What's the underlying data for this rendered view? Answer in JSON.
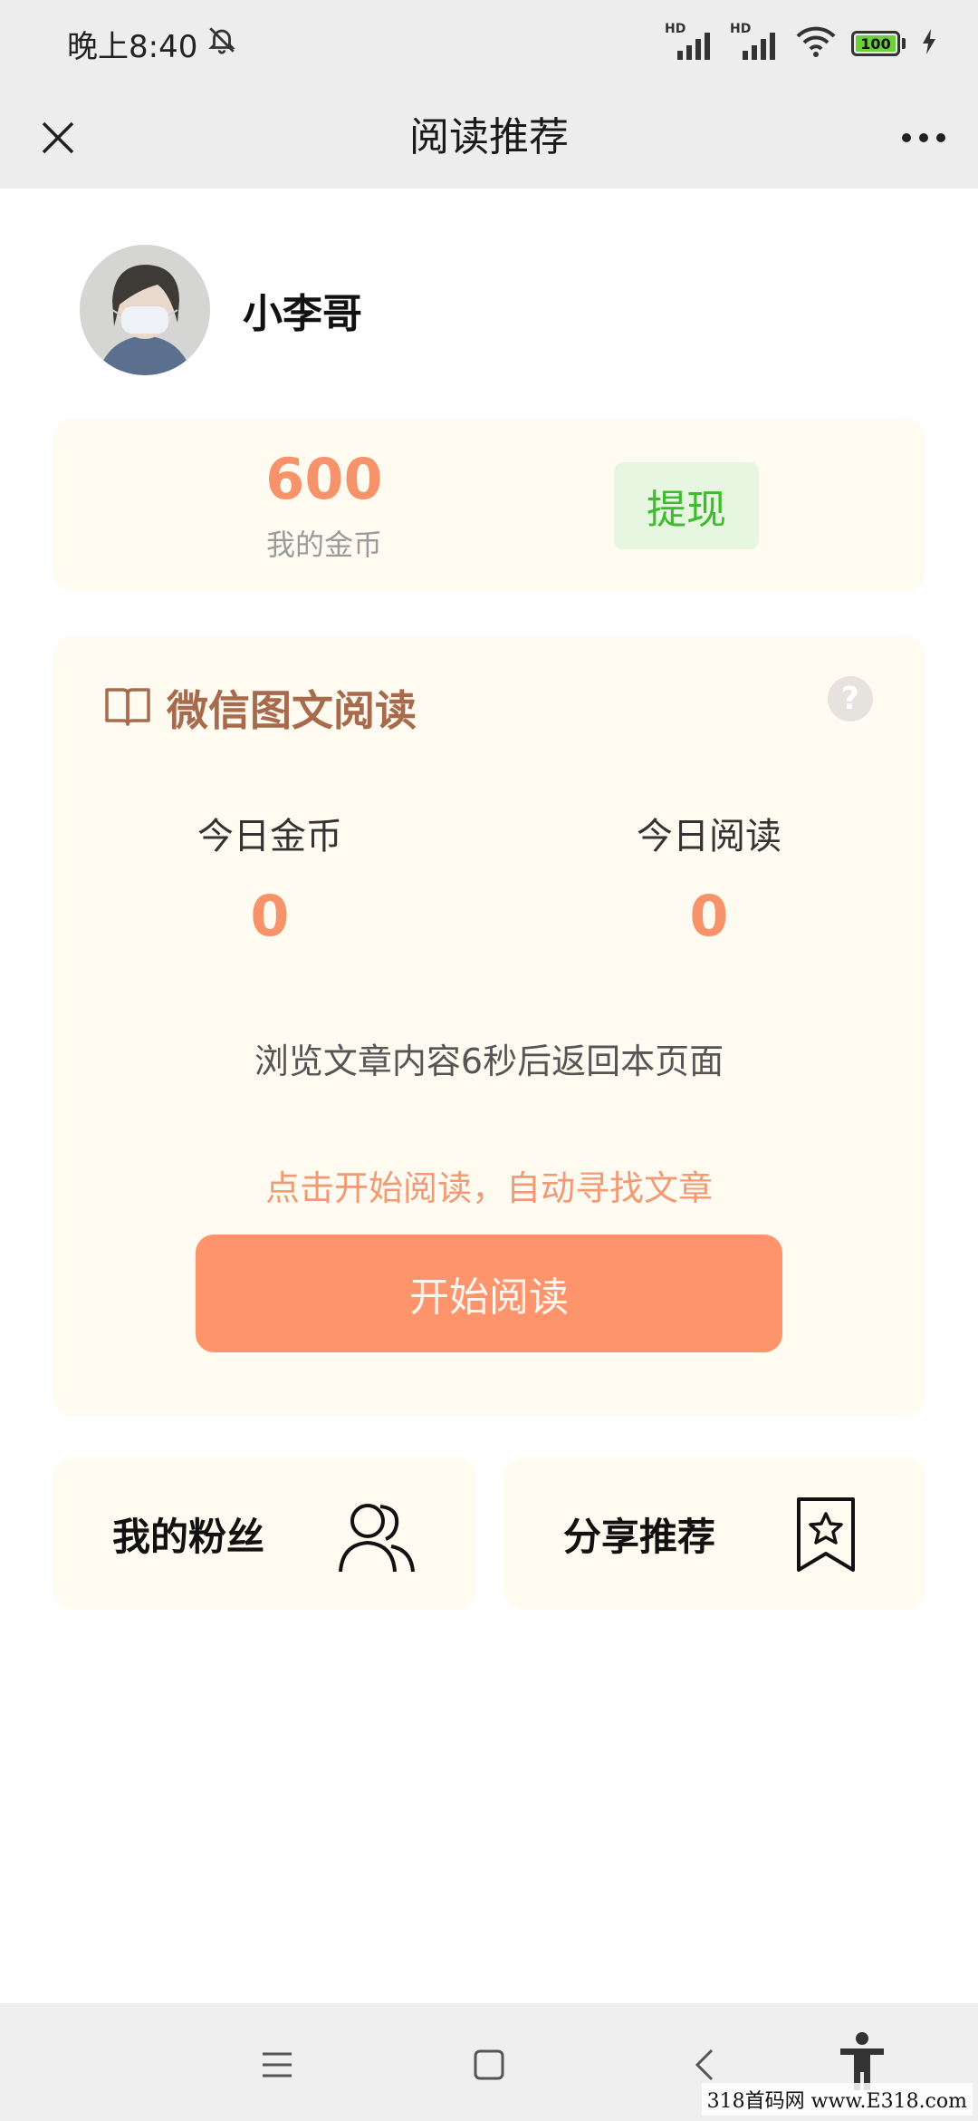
{
  "status_bar": {
    "time": "晚上8:40",
    "network_badge_1": "HD",
    "network_badge_2": "HD",
    "battery_level": "100"
  },
  "header": {
    "title": "阅读推荐"
  },
  "profile": {
    "name": "小李哥"
  },
  "coins": {
    "value": "600",
    "label": "我的金币",
    "withdraw_label": "提现"
  },
  "reading": {
    "title": "微信图文阅读",
    "help_symbol": "?",
    "today_coins_label": "今日金币",
    "today_coins_value": "0",
    "today_reads_label": "今日阅读",
    "today_reads_value": "0",
    "browse_hint": "浏览文章内容6秒后返回本页面",
    "start_hint": "点击开始阅读，自动寻找文章",
    "start_button_label": "开始阅读"
  },
  "actions": {
    "fans_label": "我的粉丝",
    "share_label": "分享推荐"
  },
  "watermark": "318首码网 www.E318.com",
  "colors": {
    "accent_orange": "#fe946c",
    "coin_orange": "#f7936a",
    "withdraw_green": "#3ebd2c",
    "card_background": "#fffbf0",
    "reading_title_brown": "#a86a4d"
  },
  "icons": {
    "close": "close-icon",
    "more": "more-icon",
    "book": "book-icon",
    "help": "help-icon",
    "fans": "users-icon",
    "share": "bookmark-star-icon",
    "nav_menu": "menu-icon",
    "nav_home": "home-square-icon",
    "nav_back": "back-chevron-icon",
    "accessibility": "accessibility-icon"
  }
}
